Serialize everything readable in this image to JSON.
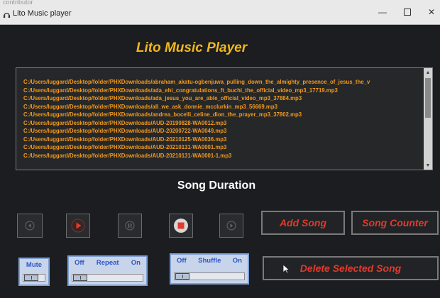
{
  "window": {
    "faint_text": "contributor",
    "title": "Lito  Music player"
  },
  "app": {
    "title": "Lito Music Player"
  },
  "playlist": {
    "items": [
      "C:/Users/luggard/Desktop/folder/PHXDownloads/abraham_akatu-ogbenjuwa_pulling_down_the_almighty_presence_of_jesus_the_v",
      "C:/Users/luggard/Desktop/folder/PHXDownloads/ada_ehi_congratulations_ft_buchi_the_official_video_mp3_17719.mp3",
      "C:/Users/luggard/Desktop/folder/PHXDownloads/ada_jesus_you_are_able_official_video_mp3_37884.mp3",
      "C:/Users/luggard/Desktop/folder/PHXDownloads/all_we_ask_donnie_mcclurkin_mp3_56669.mp3",
      "C:/Users/luggard/Desktop/folder/PHXDownloads/andrea_bocelli_celine_dion_the_prayer_mp3_37802.mp3",
      "C:/Users/luggard/Desktop/folder/PHXDownloads/AUD-20190828-WA0012.mp3",
      "C:/Users/luggard/Desktop/folder/PHXDownloads/AUD-20200722-WA0049.mp3",
      "C:/Users/luggard/Desktop/folder/PHXDownloads/AUD-20210125-WA0036.mp3",
      "C:/Users/luggard/Desktop/folder/PHXDownloads/AUD-20210131-WA0001.mp3",
      "C:/Users/luggard/Desktop/folder/PHXDownloads/AUD-20210131-WA0001-1.mp3"
    ]
  },
  "duration": {
    "label": "Song Duration"
  },
  "buttons": {
    "add_song": "Add Song",
    "song_counter": "Song Counter",
    "delete_selected": "Delete Selected Song"
  },
  "toggles": {
    "mute": {
      "label": "Mute",
      "value": 0
    },
    "repeat": {
      "off": "Off",
      "label": "Repeat",
      "on": "On",
      "value": 0
    },
    "shuffle": {
      "off": "Off",
      "label": "Shuffle",
      "on": "On",
      "value": 0
    }
  },
  "colors": {
    "accent_title": "#f0b81c",
    "list_text": "#f39a1c",
    "button_text": "#e23a2c",
    "toggle_text": "#2c56c9"
  },
  "icons": {
    "previous": "previous-icon",
    "play": "play-icon",
    "pause": "pause-icon",
    "stop": "stop-icon",
    "next": "next-icon",
    "cursor": "mouse-cursor-icon"
  }
}
